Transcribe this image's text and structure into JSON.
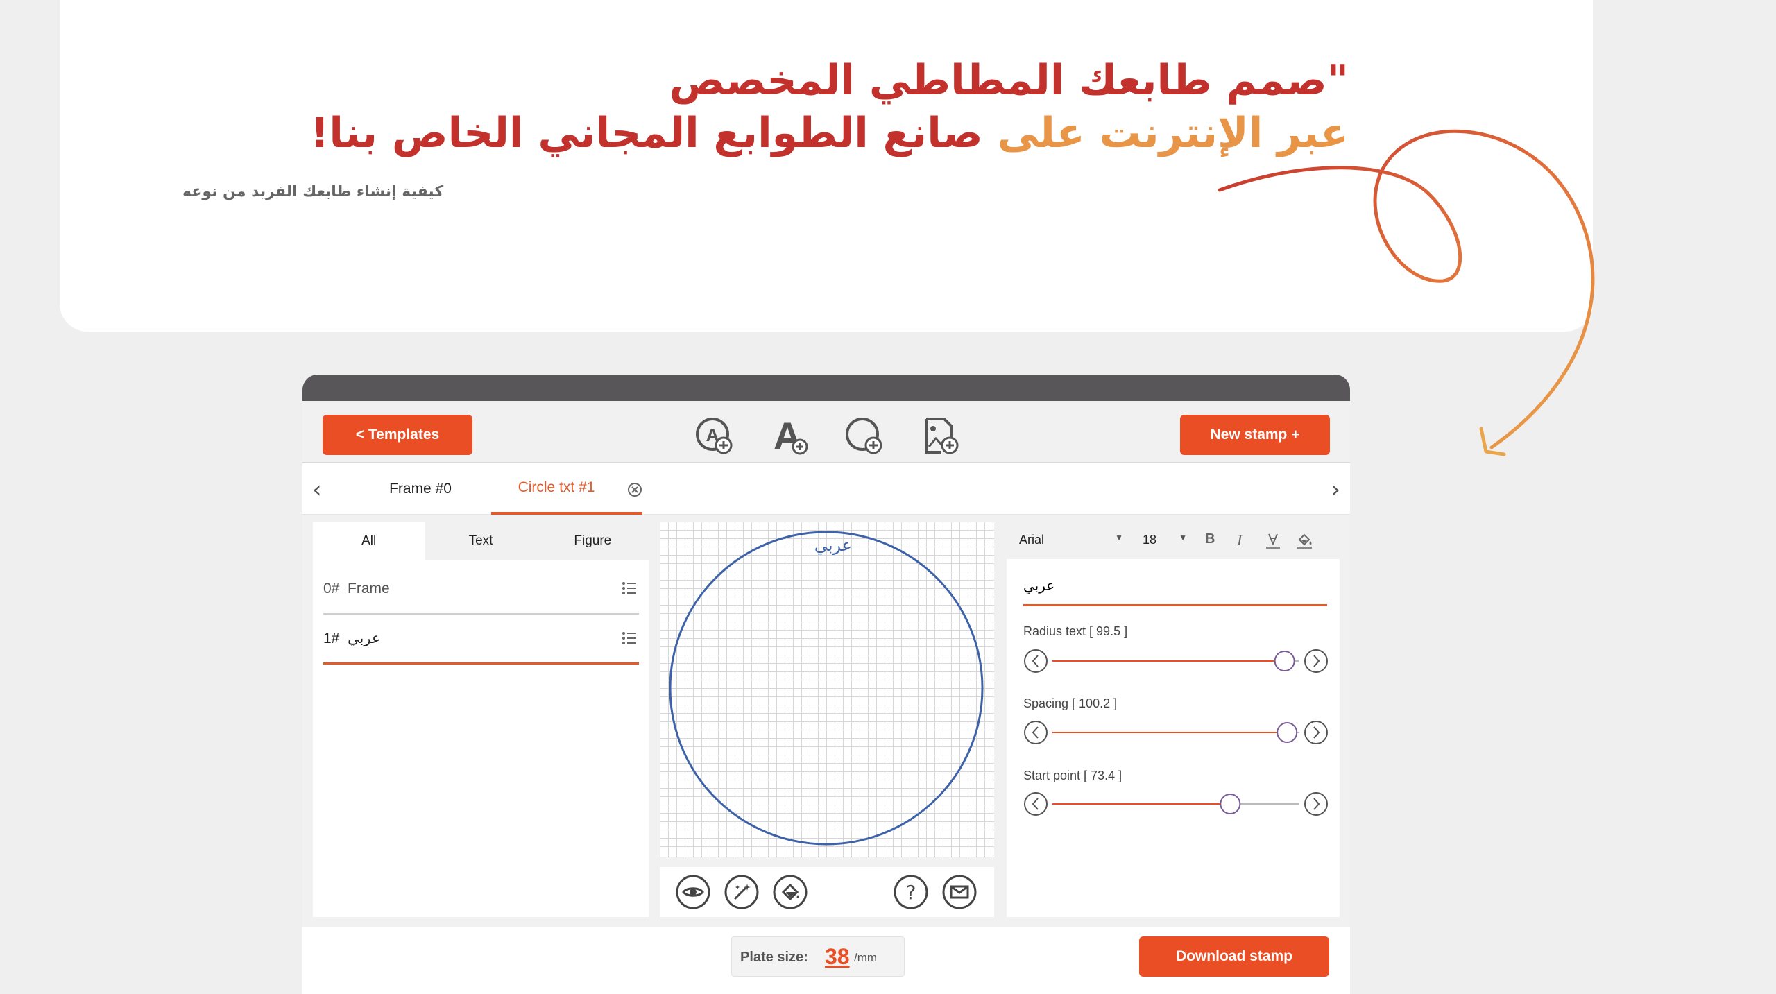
{
  "hero": {
    "title_line1": "\"صمم طابعك المطاطي المخصص",
    "title_line2_a": "عبر الإنترنت على ",
    "title_line2_b": "صانع الطوابع المجاني الخاص بنا!",
    "subtitle": "كيفية إنشاء طابعك الفريد من نوعه"
  },
  "toolbar": {
    "templates_label": "<  Templates",
    "new_stamp_label": "New stamp +"
  },
  "tabs": {
    "items": [
      "Frame #0",
      "Circle txt #1"
    ],
    "active": "Circle txt #1"
  },
  "filter_tabs": [
    "All",
    "Text",
    "Figure"
  ],
  "layers": [
    {
      "index": "0#",
      "name": "Frame"
    },
    {
      "index": "1#",
      "name": "عربي"
    }
  ],
  "canvas": {
    "circle_text": "عربي"
  },
  "props": {
    "font": "Arial",
    "size": "18",
    "text_value": "عربي",
    "sliders": [
      {
        "label": "Radius text [ 99.5 ]",
        "position": 0.94
      },
      {
        "label": "Spacing [ 100.2 ]",
        "position": 0.95
      },
      {
        "label": "Start point [ 73.4 ]",
        "position": 0.72
      }
    ]
  },
  "footer": {
    "plate_label": "Plate size:",
    "plate_value": "38",
    "plate_unit": "/mm",
    "download_label": "Download stamp"
  },
  "colors": {
    "accent": "#ea4e24",
    "circle": "#3d62a8",
    "slider_thumb": "#7a5c9a"
  }
}
